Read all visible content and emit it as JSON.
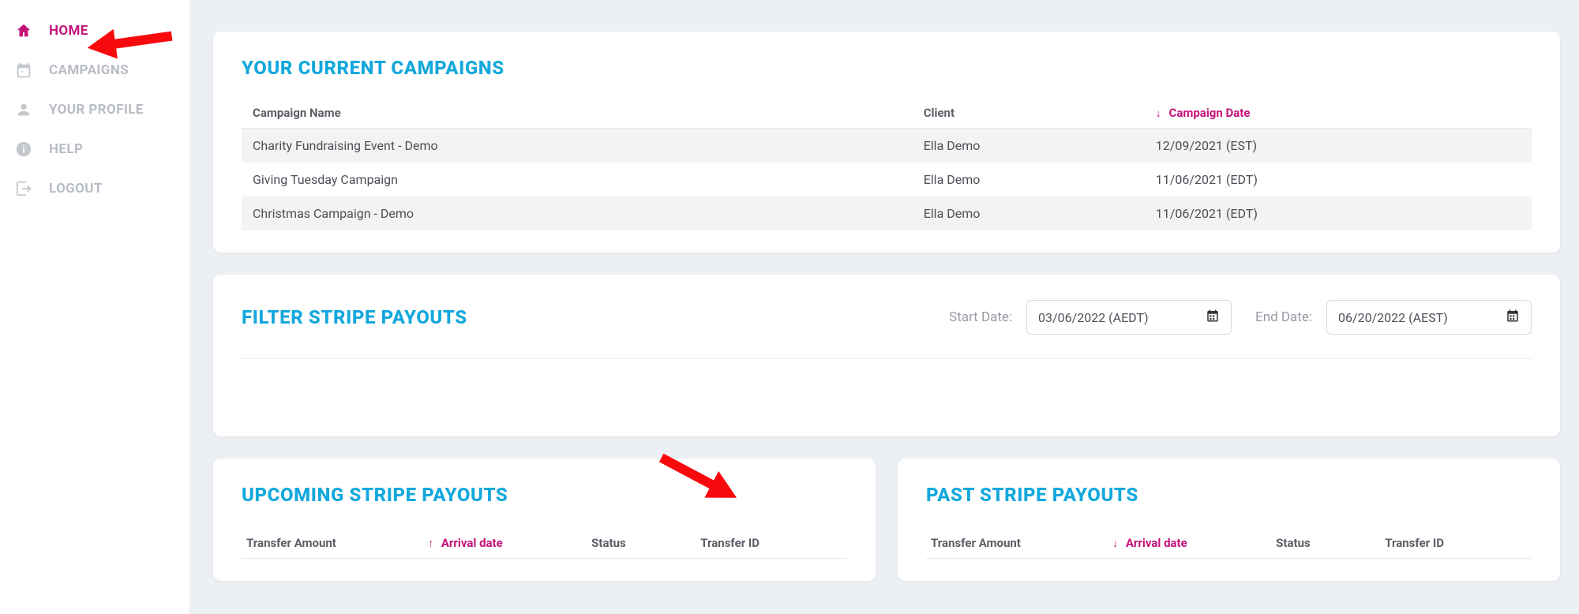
{
  "sidebar": {
    "items": [
      {
        "label": "HOME",
        "icon": "home",
        "active": true
      },
      {
        "label": "CAMPAIGNS",
        "icon": "calendar",
        "active": false
      },
      {
        "label": "YOUR PROFILE",
        "icon": "user",
        "active": false
      },
      {
        "label": "HELP",
        "icon": "info",
        "active": false
      },
      {
        "label": "LOGOUT",
        "icon": "logout",
        "active": false
      }
    ]
  },
  "campaigns": {
    "title": "YOUR CURRENT CAMPAIGNS",
    "columns": {
      "name": "Campaign Name",
      "client": "Client",
      "date": "Campaign Date"
    },
    "sort_dir": "down",
    "rows": [
      {
        "name": "Charity Fundraising Event - Demo",
        "client": "Ella Demo",
        "date": "12/09/2021 (EST)"
      },
      {
        "name": "Giving Tuesday Campaign",
        "client": "Ella Demo",
        "date": "11/06/2021 (EDT)"
      },
      {
        "name": "Christmas Campaign - Demo",
        "client": "Ella Demo",
        "date": "11/06/2021 (EDT)"
      }
    ]
  },
  "filter": {
    "title": "FILTER STRIPE PAYOUTS",
    "start_label": "Start Date:",
    "start_value": "03/06/2022 (AEDT)",
    "end_label": "End Date:",
    "end_value": "06/20/2022 (AEST)"
  },
  "upcoming": {
    "title": "UPCOMING STRIPE PAYOUTS",
    "columns": {
      "amount": "Transfer Amount",
      "arrival": "Arrival date",
      "status": "Status",
      "id": "Transfer ID"
    },
    "sort_dir": "up"
  },
  "past": {
    "title": "PAST STRIPE PAYOUTS",
    "columns": {
      "amount": "Transfer Amount",
      "arrival": "Arrival date",
      "status": "Status",
      "id": "Transfer ID"
    },
    "sort_dir": "down"
  }
}
